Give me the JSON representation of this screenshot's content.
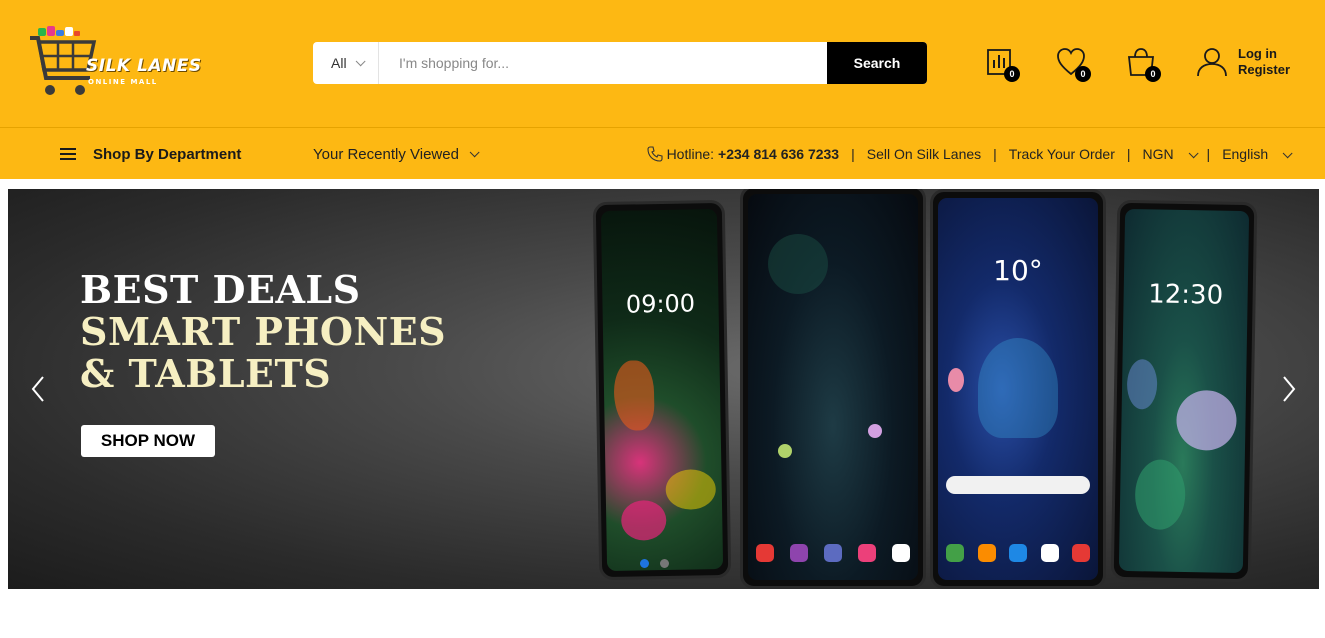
{
  "brand": {
    "name": "SILK LANES",
    "tagline": "ONLINE MALL"
  },
  "search": {
    "category": "All",
    "placeholder": "I'm shopping for...",
    "button_label": "Search"
  },
  "header_icons": {
    "compare_count": "0",
    "wishlist_count": "0",
    "cart_count": "0"
  },
  "account": {
    "login_label": "Log in",
    "register_label": "Register"
  },
  "nav": {
    "department_label": "Shop By Department",
    "recently_viewed_label": "Your Recently Viewed",
    "hotline_label": "Hotline:",
    "hotline_number": "+234 814 636 7233",
    "sell_label": "Sell On Silk Lanes",
    "track_label": "Track Your Order",
    "currency": "NGN",
    "language": "English"
  },
  "hero": {
    "line1": "BEST DEALS",
    "line2": "SMART PHONES",
    "line3": "& TABLETS",
    "cta_label": "SHOP NOW",
    "phone1_time": "09:00",
    "phone3_temp": "10°",
    "phone4_time": "12:30"
  },
  "colors": {
    "brand_yellow": "#fdb813",
    "search_button": "#000000",
    "active_dot": "#1e74e0"
  }
}
